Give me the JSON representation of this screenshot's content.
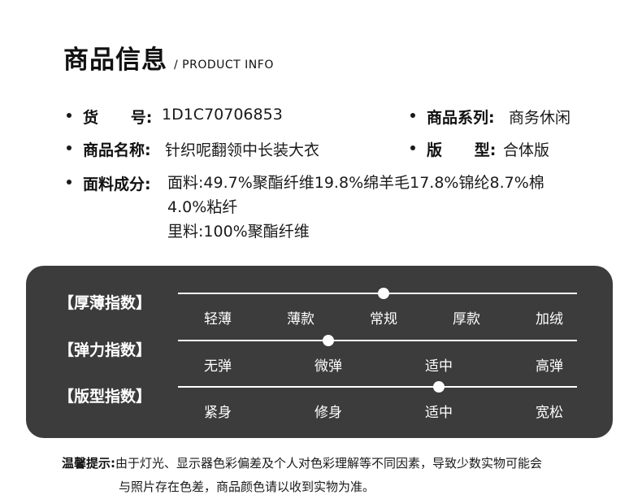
{
  "header": {
    "title": "商品信息",
    "subtitle": "/ PRODUCT INFO"
  },
  "info": {
    "code": {
      "label": "货      号:",
      "value": "1D1C70706853"
    },
    "series": {
      "label": "商品系列:",
      "value": "商务休闲"
    },
    "name": {
      "label": "商品名称:",
      "value": "针织呢翻领中长装大衣"
    },
    "fit": {
      "label": "版      型:",
      "value": "合体版"
    },
    "fabric": {
      "label": "面料成分:",
      "lines": [
        "面料:49.7%聚酯纤维19.8%绵羊毛17.8%锦纶8.7%棉",
        "4.0%粘纤",
        "里料:100%聚酯纤维"
      ]
    }
  },
  "indices": [
    {
      "label": "【厚薄指数】",
      "options": [
        "轻薄",
        "薄款",
        "常规",
        "厚款",
        "加绒"
      ],
      "selected": 2
    },
    {
      "label": "【弹力指数】",
      "options": [
        "无弹",
        "微弹",
        "适中",
        "高弹"
      ],
      "selected": 1
    },
    {
      "label": "【版型指数】",
      "options": [
        "紧身",
        "修身",
        "适中",
        "宽松"
      ],
      "selected": 2
    }
  ],
  "tip": {
    "label": "温馨提示:",
    "line1": "由于灯光、显示器色彩偏差及个人对色彩理解等不同因素，导致少数实物可能会",
    "line2": "与照片存在色差，商品颜色请以收到实物为准。"
  },
  "colors": {
    "panel_bg": "#3c3c3c",
    "text": "#1a1a1a",
    "panel_text": "#ffffff"
  }
}
